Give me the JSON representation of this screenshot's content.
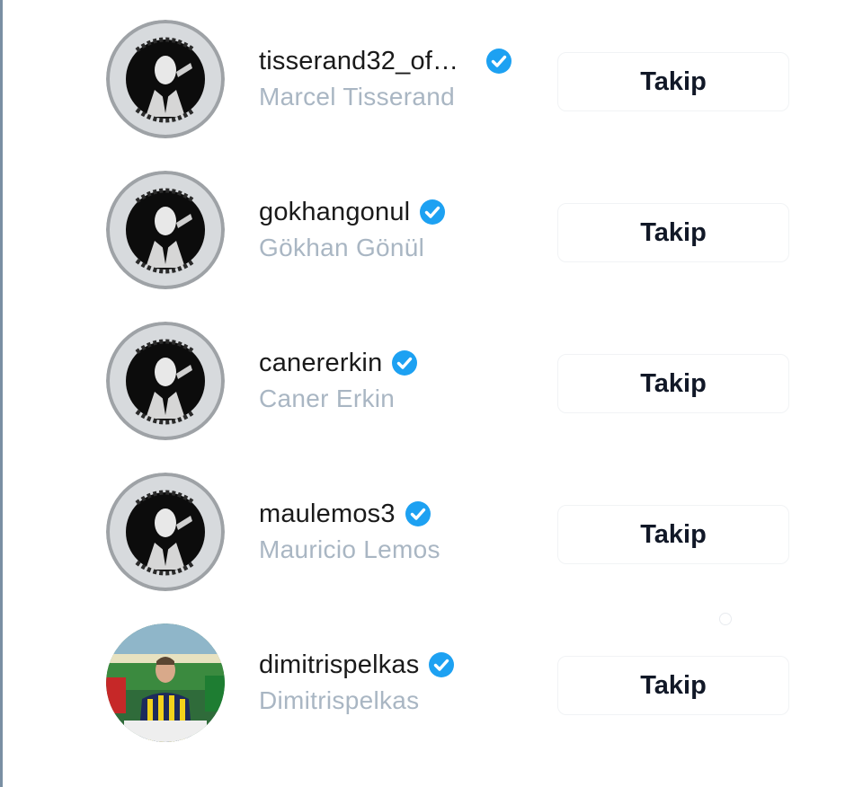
{
  "follow_label": "Takip",
  "accent_color": "#1da1f2",
  "users": [
    {
      "username": "tisserand32_of…",
      "full_name": "Marcel Tisserand",
      "verified": true,
      "avatar": "bw-portrait-logo",
      "avatar_text": "#BizSeniz"
    },
    {
      "username": "gokhangonul",
      "full_name": "Gökhan Gönül",
      "verified": true,
      "avatar": "bw-portrait-logo",
      "avatar_text": "#BizSeniz"
    },
    {
      "username": "canererkin",
      "full_name": "Caner Erkin",
      "verified": true,
      "avatar": "bw-portrait-logo",
      "avatar_text": "#BizSeniz"
    },
    {
      "username": "maulemos3",
      "full_name": "Mauricio Lemos",
      "verified": true,
      "avatar": "bw-portrait-logo",
      "avatar_text": "#BizSeniz"
    },
    {
      "username": "dimitrispelkas",
      "full_name": "Dimitrispelkas",
      "verified": true,
      "avatar": "photo-player-jersey"
    }
  ]
}
